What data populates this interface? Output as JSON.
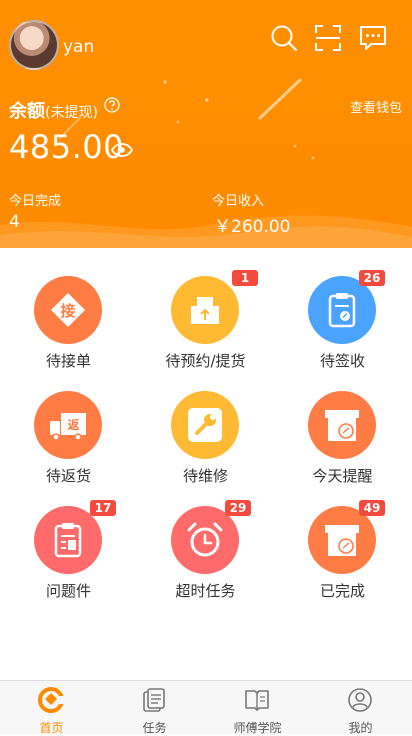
{
  "header": {
    "username": "yan",
    "balance_label": "余额",
    "balance_note": "(未提现)",
    "wallet_link": "查看钱包",
    "balance_amount": "485.00",
    "today_done_label": "今日完成",
    "today_done_value": "4",
    "today_income_label": "今日收入",
    "today_income_value": "￥260.00",
    "icons": [
      "search-icon",
      "scan-icon",
      "message-icon",
      "help-icon",
      "eye-icon"
    ]
  },
  "grid": {
    "items": [
      {
        "label": "待接单",
        "badge": "",
        "color": "#ff7d45",
        "icon": "accept-order-icon"
      },
      {
        "label": "待预约/提货",
        "badge": "1",
        "color": "#ffb932",
        "icon": "package-pickup-icon"
      },
      {
        "label": "待签收",
        "badge": "26",
        "color": "#4aa3ff",
        "icon": "sign-clipboard-icon"
      },
      {
        "label": "待返货",
        "badge": "",
        "color": "#ff7d45",
        "icon": "return-truck-icon"
      },
      {
        "label": "待维修",
        "badge": "",
        "color": "#ffb932",
        "icon": "wrench-icon"
      },
      {
        "label": "今天提醒",
        "badge": "",
        "color": "#ff7d45",
        "icon": "reminder-box-icon"
      },
      {
        "label": "问题件",
        "badge": "17",
        "color": "#ff6a6a",
        "icon": "problem-clipboard-icon"
      },
      {
        "label": "超时任务",
        "badge": "29",
        "color": "#ff6a6a",
        "icon": "alarm-clock-icon"
      },
      {
        "label": "已完成",
        "badge": "49",
        "color": "#ff7d45",
        "icon": "completed-box-icon"
      }
    ]
  },
  "tabbar": {
    "tabs": [
      {
        "label": "首页",
        "icon": "home-icon",
        "active": true
      },
      {
        "label": "任务",
        "icon": "task-icon",
        "active": false
      },
      {
        "label": "师傅学院",
        "icon": "academy-book-icon",
        "active": false
      },
      {
        "label": "我的",
        "icon": "profile-icon",
        "active": false
      }
    ]
  },
  "colors": {
    "primary": "#ff8a00",
    "badge": "#f24a3d"
  }
}
